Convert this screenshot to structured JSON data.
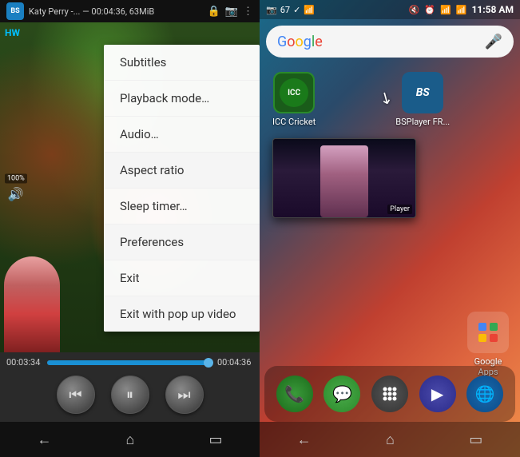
{
  "left": {
    "statusBar": {
      "title": "Katy Perry -...",
      "subtitle": "00:04:36, 63MiB"
    },
    "hw": "HW",
    "volume": "100%",
    "menu": {
      "items": [
        {
          "id": "subtitles",
          "label": "Subtitles"
        },
        {
          "id": "playback",
          "label": "Playback mode…"
        },
        {
          "id": "audio",
          "label": "Audio…"
        },
        {
          "id": "aspect",
          "label": "Aspect ratio"
        },
        {
          "id": "sleep",
          "label": "Sleep timer…"
        },
        {
          "id": "prefs",
          "label": "Preferences"
        },
        {
          "id": "exit",
          "label": "Exit"
        },
        {
          "id": "exit-popup",
          "label": "Exit with pop up video"
        }
      ]
    },
    "controls": {
      "timeStart": "00:03:34",
      "timeEnd": "00:04:36"
    },
    "nav": {
      "back": "←",
      "home": "⌂",
      "recent": "▭"
    }
  },
  "right": {
    "statusBar": {
      "time": "11:58",
      "am_pm": "AM"
    },
    "search": {
      "logo": "Google",
      "mic_label": "mic"
    },
    "apps": {
      "icc": {
        "label": "ICC Cricket",
        "text": "ICC"
      },
      "bsplayer": {
        "label": "BSPlayer FR...",
        "text": "BS"
      }
    },
    "dock": {
      "phone": "📞",
      "message": "💬",
      "apps": "⋯",
      "store": "▶",
      "browser": "🌐"
    },
    "googleApps": {
      "label": "Google Apps"
    },
    "popup_label": "Player",
    "nav": {
      "back": "←",
      "home": "⌂",
      "recent": "▭"
    }
  }
}
